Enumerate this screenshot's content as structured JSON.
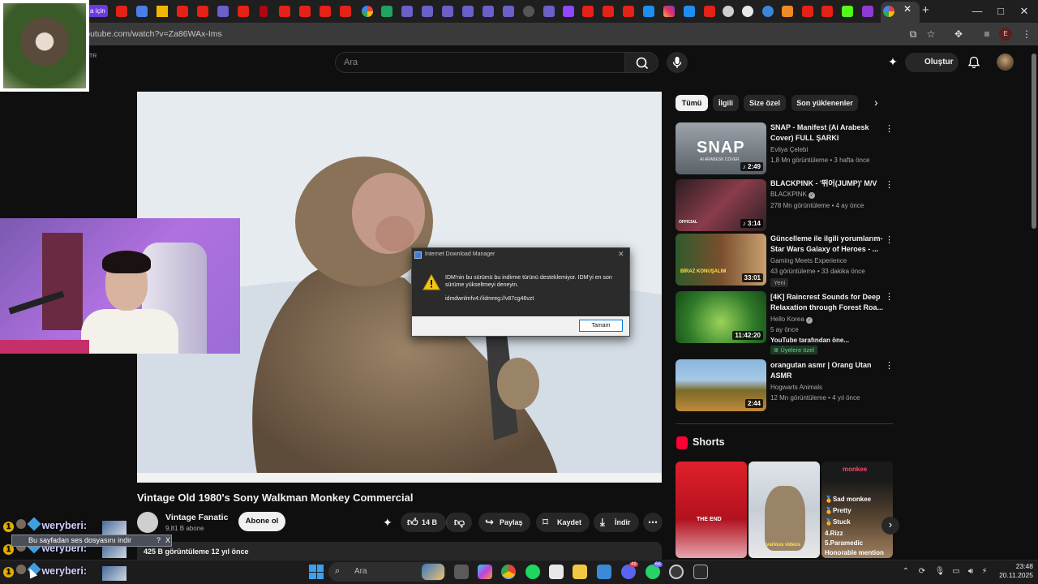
{
  "browser": {
    "url": "youtube.com/watch?v=Za86WAx-Ims",
    "partial_tab_text": "a için",
    "profile_initial": "E",
    "window_buttons": [
      "—",
      "□",
      "✕"
    ]
  },
  "youtube": {
    "country_code": "TR",
    "search_placeholder": "Ara",
    "create_label": "Oluştur",
    "video": {
      "title": "Vintage Old 1980's Sony Walkman Monkey Commercial",
      "channel": "Vintage Fanatic",
      "subscribers": "9,81 B abone",
      "subscribe_label": "Abone ol",
      "likes": "14 B",
      "share_label": "Paylaş",
      "save_label": "Kaydet",
      "download_label": "İndir",
      "meta": "425 B görüntüleme  12 yıl önce"
    },
    "chips": [
      "Tümü",
      "İlgili",
      "Size özel",
      "Son yüklenenler"
    ],
    "recommendations": [
      {
        "title": "SNAP - Manifest (Ai Arabesk Cover) FULL ŞARKI",
        "channel": "Evliya Çelebi",
        "stats": "1,8 Mn görüntüleme • 3 hafta önce",
        "duration": "♪ 2:49",
        "thumb_text": "SNAP",
        "thumb_sub": "AI ARABESK COVER"
      },
      {
        "title": "BLACKPINK - '뛰어(JUMP)' M/V",
        "channel": "BLACKPINK",
        "stats": "278 Mn görüntüleme • 4 ay önce",
        "duration": "♪ 3:14",
        "thumb_text": "OFFICIAL"
      },
      {
        "title": "Güncelleme ile ilgili yorumlarım- Star Wars Galaxy of Heroes - ...",
        "channel": "Gaming Meets Experience",
        "stats": "43 görüntüleme • 33 dakika önce",
        "duration": "33:01",
        "badge": "Yeni",
        "thumb_text": "BİRAZ KONUŞALIM"
      },
      {
        "title": "[4K] Raincrest Sounds for Deep Relaxation through Forest Roa...",
        "channel": "Hello Korea",
        "stats": "5 ay önce",
        "duration": "11:42:20",
        "extra": "YouTube tarafından öne...",
        "members": "Üyelere özel"
      },
      {
        "title": "orangutan asmr | Orang Utan ASMR",
        "channel": "Hogwarts Animals",
        "stats": "12 Mn görüntüleme • 4 yıl önce",
        "duration": "2:44"
      }
    ],
    "shorts_title": "Shorts",
    "shorts": [
      {
        "caption": "THE END"
      },
      {
        "caption": "various videos"
      },
      {
        "header": "monkee",
        "lines": [
          "🏅Sad monkee",
          "🏅Pretty",
          "🏅Stuck",
          "4.Rizz",
          "5.Paramedic",
          "Honorable mention"
        ]
      }
    ]
  },
  "idm_dialog": {
    "title": "Internet Download Manager",
    "message": "IDM'nin bu sürümü bu indirme türünü desteklemiyor. IDM'yi en son sürüme yükseltmeyi deneyin.",
    "link": "idmdwnlmfv4://idmreg://v87cg46vzt",
    "ok_label": "Tamam"
  },
  "chat": {
    "lines": [
      {
        "badge": "1",
        "user": "weryberi:"
      },
      {
        "badge": "1",
        "user": "weryberi:"
      },
      {
        "badge": "1",
        "user": "weryberi:"
      }
    ],
    "tooltip": "Bu sayfadan ses dosyasını indir",
    "tooltip_icons": [
      "?",
      "X"
    ]
  },
  "taskbar": {
    "search_placeholder": "Ara",
    "time": "23:48",
    "date": "20.11.2025",
    "discord_badge": "49",
    "whatsapp_badge": "68"
  }
}
